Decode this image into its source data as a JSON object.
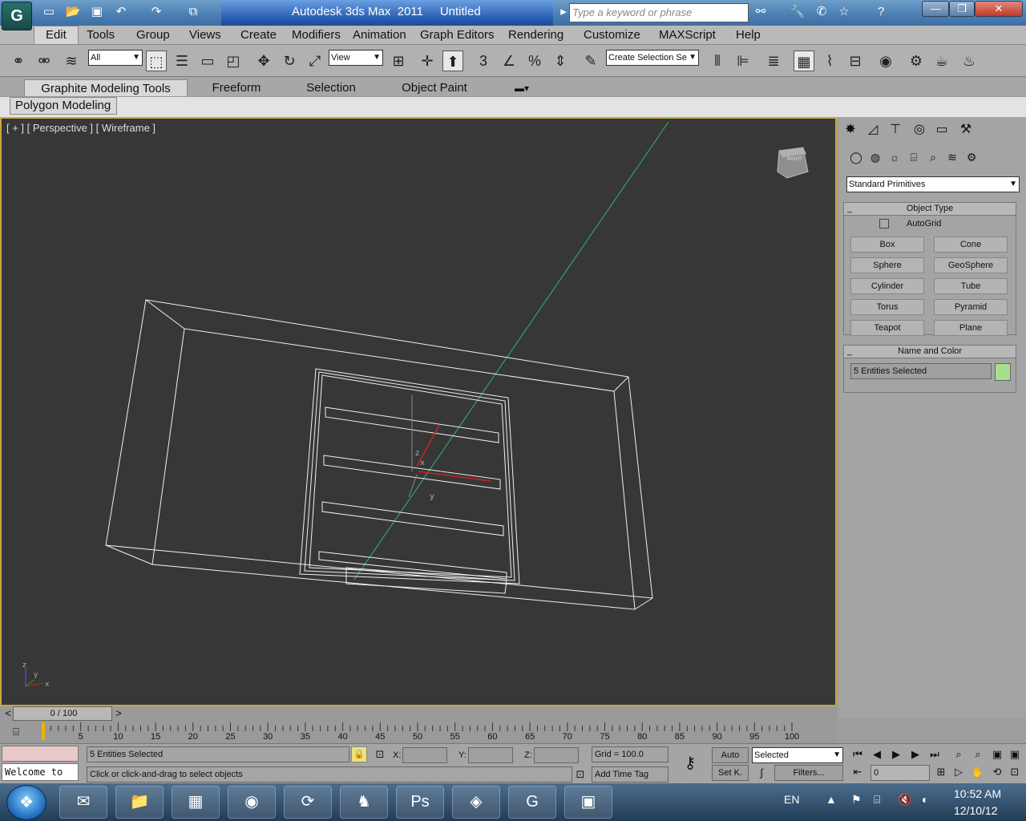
{
  "titlebar": {
    "app_title": "Autodesk 3ds Max  2011",
    "doc_title": "Untitled",
    "search_placeholder": "Type a keyword or phrase",
    "minimize": "—",
    "maximize": "❐",
    "close": "✕"
  },
  "menu": [
    "Edit",
    "Tools",
    "Group",
    "Views",
    "Create",
    "Modifiers",
    "Animation",
    "Graph Editors",
    "Rendering",
    "Customize",
    "MAXScript",
    "Help"
  ],
  "toolbar": {
    "selection_filter": "All",
    "reference_coord": "View",
    "named_selection": "Create Selection Se",
    "snap_label": "3"
  },
  "ribbon": {
    "tabs": [
      "Graphite Modeling Tools",
      "Freeform",
      "Selection",
      "Object Paint"
    ],
    "panel": "Polygon Modeling"
  },
  "viewport": {
    "label": "[ + ] [ Perspective ] [ Wireframe ]",
    "viewcube_face": "RIGHT",
    "axis_x": "x",
    "axis_y": "y",
    "axis_z": "z"
  },
  "command_panel": {
    "category": "Standard Primitives",
    "object_type_title": "Object Type",
    "autogrid": "AutoGrid",
    "primitives": [
      "Box",
      "Cone",
      "Sphere",
      "GeoSphere",
      "Cylinder",
      "Tube",
      "Torus",
      "Pyramid",
      "Teapot",
      "Plane"
    ],
    "name_color_title": "Name and Color",
    "name_value": "5 Entities Selected",
    "object_color": "#a6e08f"
  },
  "timeline": {
    "frame": "0 / 100",
    "ticks": [
      "5",
      "10",
      "15",
      "20",
      "25",
      "30",
      "35",
      "40",
      "45",
      "50",
      "55",
      "60",
      "65",
      "70",
      "75",
      "80",
      "85",
      "90",
      "95",
      "100"
    ]
  },
  "status": {
    "maxscript_listener": "Welcome to",
    "selection_text": "5 Entities Selected",
    "prompt": "Click or click-and-drag to select objects",
    "x_label": "X:",
    "y_label": "Y:",
    "z_label": "Z:",
    "grid": "Grid = 100.0",
    "add_time_tag": "Add Time Tag",
    "auto": "Auto",
    "set_key": "Set K.",
    "key_filter": "Selected",
    "filters": "Filters...",
    "current_frame": "0"
  },
  "taskbar": {
    "lang": "EN",
    "time": "10:52 AM",
    "date": "12/10/12",
    "apps": [
      "outlook-icon",
      "explorer-icon",
      "uni-icon",
      "chrome-icon",
      "network-icon",
      "squirrel-icon",
      "photoshop-icon",
      "app-icon",
      "3dsmax-icon",
      "image-viewer-icon"
    ]
  }
}
